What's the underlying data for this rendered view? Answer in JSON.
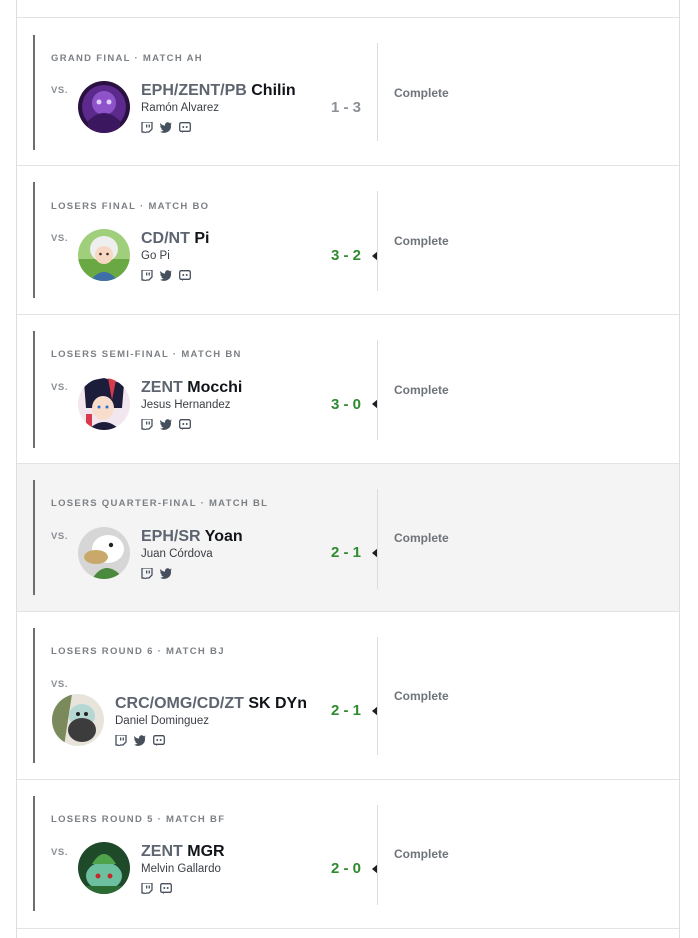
{
  "matches": [
    {
      "round": "GRAND FINAL · MATCH AH",
      "vs": "VS.",
      "team": "EPH/ZENT/PB",
      "tag": "Chilin",
      "realname": "Ramón Alvarez",
      "score": "1 - 3",
      "result": "loss",
      "status": "Complete",
      "socials": [
        "twitch-icon",
        "twitter-icon",
        "discord-icon"
      ]
    },
    {
      "round": "LOSERS FINAL · MATCH BO",
      "vs": "VS.",
      "team": "CD/NT",
      "tag": "Pi",
      "realname": "Go Pi",
      "score": "3 - 2",
      "result": "win",
      "status": "Complete",
      "socials": [
        "twitch-icon",
        "twitter-icon",
        "discord-icon"
      ]
    },
    {
      "round": "LOSERS SEMI-FINAL · MATCH BN",
      "vs": "VS.",
      "team": "ZENT",
      "tag": "Mocchi",
      "realname": "Jesus Hernandez",
      "score": "3 - 0",
      "result": "win",
      "status": "Complete",
      "socials": [
        "twitch-icon",
        "twitter-icon",
        "discord-icon"
      ]
    },
    {
      "round": "LOSERS QUARTER-FINAL · MATCH BL",
      "vs": "VS.",
      "team": "EPH/SR",
      "tag": "Yoan",
      "realname": "Juan Córdova",
      "score": "2 - 1",
      "result": "win",
      "status": "Complete",
      "socials": [
        "twitch-icon",
        "twitter-icon"
      ]
    },
    {
      "round": "LOSERS ROUND 6 · MATCH BJ",
      "vs": "VS.",
      "team": "CRC/OMG/CD/ZT",
      "tag": "SK DYn",
      "realname": "Daniel Dominguez",
      "score": "2 - 1",
      "result": "win",
      "status": "Complete",
      "socials": [
        "twitch-icon",
        "twitter-icon",
        "discord-icon"
      ]
    },
    {
      "round": "LOSERS ROUND 5 · MATCH BF",
      "vs": "VS.",
      "team": "ZENT",
      "tag": "MGR",
      "realname": "Melvin Gallardo",
      "score": "2 - 0",
      "result": "win",
      "status": "Complete",
      "socials": [
        "twitch-icon",
        "discord-icon"
      ]
    }
  ],
  "colors": {
    "win": "#2e8b2e",
    "loss": "#8b9096",
    "highlight_row": "#f4f4f4"
  }
}
